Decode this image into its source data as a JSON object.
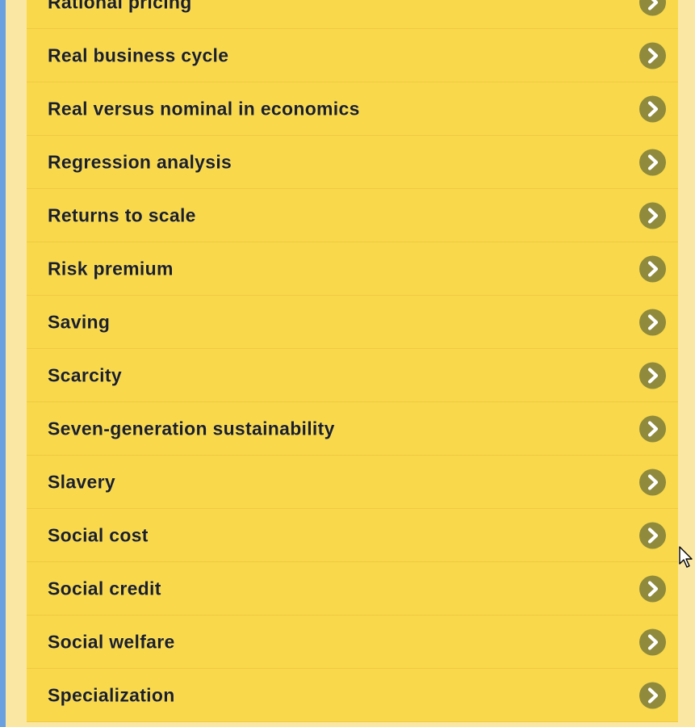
{
  "list": {
    "items": [
      {
        "label": "Rational pricing",
        "icon": "chevron-right-icon"
      },
      {
        "label": "Real business cycle",
        "icon": "chevron-right-icon"
      },
      {
        "label": "Real versus nominal in economics",
        "icon": "chevron-right-icon"
      },
      {
        "label": "Regression analysis",
        "icon": "chevron-right-icon"
      },
      {
        "label": "Returns to scale",
        "icon": "chevron-right-icon"
      },
      {
        "label": "Risk premium",
        "icon": "chevron-right-icon"
      },
      {
        "label": "Saving",
        "icon": "chevron-right-icon"
      },
      {
        "label": "Scarcity",
        "icon": "chevron-right-icon"
      },
      {
        "label": "Seven-generation sustainability",
        "icon": "chevron-right-icon"
      },
      {
        "label": "Slavery",
        "icon": "chevron-right-icon"
      },
      {
        "label": "Social cost",
        "icon": "chevron-right-icon"
      },
      {
        "label": "Social credit",
        "icon": "chevron-right-icon"
      },
      {
        "label": "Social welfare",
        "icon": "chevron-right-icon"
      },
      {
        "label": "Specialization",
        "icon": "chevron-right-icon"
      }
    ]
  },
  "colors": {
    "item_background": "#f9d94b",
    "gutter": "#fbe7a4",
    "left_edge": "#6a9fe0",
    "chevron_circle": "#8f8a3c",
    "text": "#1d1f26"
  },
  "cursor": {
    "icon": "mouse-pointer-icon"
  }
}
